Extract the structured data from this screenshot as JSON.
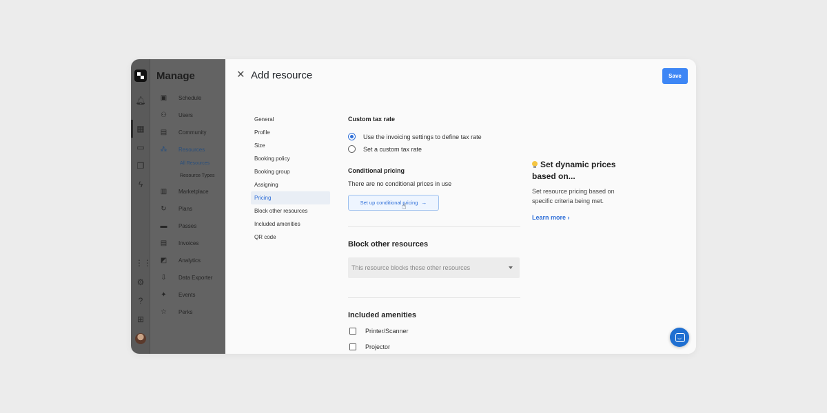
{
  "sidebar": {
    "title": "Manage",
    "items": [
      {
        "label": "Schedule",
        "icon": "calendar-icon"
      },
      {
        "label": "Users",
        "icon": "users-icon"
      },
      {
        "label": "Community",
        "icon": "chat-icon"
      },
      {
        "label": "Resources",
        "icon": "resources-icon",
        "active": true
      },
      {
        "label": "Marketplace",
        "icon": "store-icon"
      },
      {
        "label": "Plans",
        "icon": "refresh-icon"
      },
      {
        "label": "Passes",
        "icon": "pass-icon"
      },
      {
        "label": "Invoices",
        "icon": "invoice-icon"
      },
      {
        "label": "Analytics",
        "icon": "chart-icon"
      },
      {
        "label": "Data Exporter",
        "icon": "export-icon"
      },
      {
        "label": "Events",
        "icon": "event-icon"
      },
      {
        "label": "Perks",
        "icon": "star-icon"
      }
    ],
    "subitems": [
      {
        "label": "All Resources",
        "active": true
      },
      {
        "label": "Resource Types"
      }
    ]
  },
  "modal": {
    "title": "Add resource",
    "save_label": "Save",
    "nav": [
      {
        "label": "General"
      },
      {
        "label": "Profile"
      },
      {
        "label": "Size"
      },
      {
        "label": "Booking policy"
      },
      {
        "label": "Booking group"
      },
      {
        "label": "Assigning"
      },
      {
        "label": "Pricing",
        "active": true
      },
      {
        "label": "Block other resources"
      },
      {
        "label": "Included amenities"
      },
      {
        "label": "QR code"
      }
    ]
  },
  "tax": {
    "heading": "Custom tax rate",
    "options": [
      {
        "label": "Use the invoicing settings to define tax rate",
        "checked": true
      },
      {
        "label": "Set a custom tax rate",
        "checked": false
      }
    ]
  },
  "conditional": {
    "heading": "Conditional pricing",
    "note": "There are no conditional prices in use",
    "button_label": "Set up conditional pricing",
    "button_arrow": "→"
  },
  "block": {
    "heading": "Block other resources",
    "placeholder": "This resource blocks these other resources"
  },
  "amenities": {
    "heading": "Included amenities",
    "items": [
      {
        "label": "Printer/Scanner",
        "checked": false
      },
      {
        "label": "Projector",
        "checked": false
      }
    ]
  },
  "tip": {
    "title": "Set dynamic prices based on...",
    "text": "Set resource pricing based on specific criteria being met.",
    "link": "Learn more",
    "link_chevron": "›"
  },
  "colors": {
    "accent": "#3d86f5",
    "link": "#2f6fd8",
    "chat": "#1f6fd1"
  }
}
